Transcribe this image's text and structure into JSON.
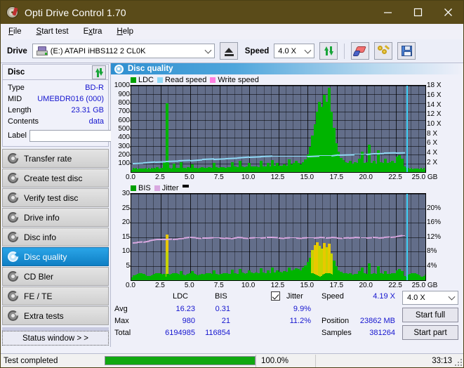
{
  "window": {
    "title": "Opti Drive Control 1.70",
    "icon": "disc-icon",
    "minimize": "minimize",
    "maximize": "maximize",
    "close": "close",
    "titlebar_color": "#5a4b19"
  },
  "menu": [
    {
      "label": "File",
      "accel": "F"
    },
    {
      "label": "Start test",
      "accel": "S"
    },
    {
      "label": "Extra",
      "accel": "x"
    },
    {
      "label": "Help",
      "accel": "H"
    }
  ],
  "toolbar": {
    "drive_label": "Drive",
    "drive_value": "(E:)  ATAPI iHBS112  2 CL0K",
    "eject_icon": "eject-icon",
    "speed_label": "Speed",
    "speed_value": "4.0 X",
    "refresh_icon": "refresh-icon",
    "erase_icon": "erase-icon",
    "keys_icon": "keys-icon",
    "save_icon": "save-icon"
  },
  "disc_panel": {
    "title": "Disc",
    "refresh_icon": "refresh-icon",
    "rows": [
      {
        "key": "Type",
        "value": "BD-R"
      },
      {
        "key": "MID",
        "value": "UMEBDR016 (000)"
      },
      {
        "key": "Length",
        "value": "23.31 GB"
      },
      {
        "key": "Contents",
        "value": "data"
      }
    ],
    "label_key": "Label",
    "label_value": "",
    "label_placeholder": "",
    "disc_button_icon": "disc-icon"
  },
  "sidebar": {
    "items": [
      {
        "label": "Transfer rate",
        "selected": false
      },
      {
        "label": "Create test disc",
        "selected": false
      },
      {
        "label": "Verify test disc",
        "selected": false
      },
      {
        "label": "Drive info",
        "selected": false
      },
      {
        "label": "Disc info",
        "selected": false
      },
      {
        "label": "Disc quality",
        "selected": true
      },
      {
        "label": "CD Bler",
        "selected": false
      },
      {
        "label": "FE / TE",
        "selected": false
      },
      {
        "label": "Extra tests",
        "selected": false
      }
    ],
    "status_window": "Status window > >"
  },
  "main": {
    "header_title": "Disc quality",
    "header_icon": "disc-quality-icon"
  },
  "stats": {
    "col_headers": [
      "LDC",
      "BIS"
    ],
    "row_labels": [
      "Avg",
      "Max",
      "Total"
    ],
    "ldc": {
      "avg": "16.23",
      "max": "980",
      "total": "6194985"
    },
    "bis": {
      "avg": "0.31",
      "max": "21",
      "total": "116854"
    },
    "jitter_label": "Jitter",
    "jitter_checked": true,
    "jitter_avg": "9.9%",
    "jitter_max": "11.2%",
    "speed_label": "Speed",
    "speed_value": "4.19 X",
    "position_label": "Position",
    "position_value": "23862 MB",
    "samples_label": "Samples",
    "samples_value": "381264",
    "speed_select": "4.0 X",
    "start_full": "Start full",
    "start_part": "Start part"
  },
  "statusbar": {
    "message": "Test completed",
    "progress_pct": "100.0%",
    "progress_value": 100,
    "elapsed": "33:13"
  },
  "chart_data": [
    {
      "type": "area",
      "name": "ldc-chart",
      "title": "",
      "xlabel": "GB",
      "ylabel": "",
      "legend": [
        {
          "label": "LDC",
          "color": "#00b400"
        },
        {
          "label": "Read speed",
          "color": "#8fd8f5"
        },
        {
          "label": "Write speed",
          "color": "#ff7fe0"
        }
      ],
      "legend_position": "top-left",
      "grid": true,
      "xlim": [
        0,
        25
      ],
      "xticks": [
        0.0,
        2.5,
        5.0,
        7.5,
        10.0,
        12.5,
        15.0,
        17.5,
        20.0,
        22.5,
        25.0
      ],
      "xtick_labels": [
        "0.0",
        "2.5",
        "5.0",
        "7.5",
        "10.0",
        "12.5",
        "15.0",
        "17.5",
        "20.0",
        "22.5",
        "25.0 GB"
      ],
      "ylim": [
        0,
        1000
      ],
      "yticks": [
        100,
        200,
        300,
        400,
        500,
        600,
        700,
        800,
        900,
        1000
      ],
      "ytick_labels": [
        "100",
        "200",
        "300",
        "400",
        "500",
        "600",
        "700",
        "800",
        "900",
        "1000"
      ],
      "y2lim": [
        0,
        18
      ],
      "y2ticks": [
        2,
        4,
        6,
        8,
        10,
        12,
        14,
        16,
        18
      ],
      "y2tick_labels": [
        "2 X",
        "4 X",
        "6 X",
        "8 X",
        "10 X",
        "12 X",
        "14 X",
        "16 X",
        "18 X"
      ],
      "cursor_x": 23.4,
      "series": [
        {
          "name": "LDC",
          "color": "#00b400",
          "x": [
            0.1,
            0.3,
            0.5,
            0.7,
            0.9,
            1.1,
            1.3,
            1.5,
            1.7,
            1.9,
            2.1,
            2.3,
            2.5,
            2.7,
            2.9,
            2.95,
            3.0,
            3.1,
            3.3,
            3.5,
            3.7,
            3.9,
            4.1,
            4.3,
            4.5,
            4.7,
            4.9,
            5.1,
            5.3,
            5.5,
            5.7,
            5.9,
            6.1,
            6.3,
            6.5,
            6.7,
            6.9,
            7.1,
            7.3,
            7.5,
            7.7,
            7.9,
            8.1,
            8.3,
            8.5,
            8.7,
            8.9,
            9.1,
            9.3,
            9.5,
            9.7,
            9.9,
            10.1,
            10.3,
            10.5,
            10.7,
            10.9,
            11.1,
            11.3,
            11.5,
            11.7,
            11.9,
            12.1,
            12.3,
            12.5,
            12.7,
            12.9,
            13.1,
            13.3,
            13.5,
            13.7,
            13.9,
            14.1,
            14.3,
            14.5,
            14.7,
            14.9,
            15.1,
            15.3,
            15.5,
            15.7,
            15.9,
            16.1,
            16.3,
            16.5,
            16.7,
            16.9,
            17.1,
            17.3,
            17.5,
            17.7,
            17.9,
            18.1,
            18.3,
            18.5,
            18.7,
            18.9,
            19.1,
            19.3,
            19.5,
            19.7,
            19.9,
            20.1,
            20.3,
            20.5,
            20.7,
            20.9,
            21.1,
            21.3,
            21.5,
            21.7,
            21.9,
            22.1,
            22.3,
            22.5,
            22.7,
            22.9,
            23.1,
            23.3
          ],
          "values": [
            45,
            40,
            38,
            42,
            40,
            44,
            38,
            40,
            42,
            45,
            60,
            48,
            50,
            120,
            800,
            520,
            110,
            55,
            48,
            100,
            52,
            50,
            120,
            55,
            48,
            60,
            52,
            90,
            55,
            48,
            52,
            60,
            55,
            50,
            58,
            52,
            110,
            60,
            55,
            58,
            62,
            55,
            60,
            58,
            120,
            65,
            60,
            130,
            70,
            62,
            68,
            110,
            70,
            65,
            70,
            62,
            130,
            70,
            65,
            110,
            68,
            140,
            75,
            110,
            80,
            75,
            90,
            80,
            150,
            95,
            110,
            130,
            110,
            95,
            120,
            150,
            210,
            300,
            430,
            560,
            700,
            820,
            760,
            900,
            820,
            980,
            700,
            520,
            340,
            240,
            170,
            140,
            120,
            110,
            130,
            100,
            120,
            110,
            160,
            240,
            110,
            120,
            320,
            110,
            130,
            100,
            260,
            120,
            110,
            160,
            110,
            120,
            130,
            110,
            180,
            200,
            160,
            70,
            50
          ]
        },
        {
          "name": "Read speed",
          "color": "#8fd8f5",
          "x": [
            0.1,
            1.0,
            2.0,
            2.9,
            4.0,
            5.0,
            6.0,
            7.0,
            8.0,
            9.0,
            10.0,
            11.0,
            12.0,
            13.0,
            14.0,
            15.0,
            16.0,
            17.0,
            17.6,
            19.0,
            20.0,
            20.6,
            21.5,
            22.5,
            23.3
          ],
          "values": [
            2.0,
            2.1,
            2.3,
            2.4,
            2.5,
            2.6,
            2.8,
            2.9,
            3.0,
            3.1,
            3.3,
            3.4,
            3.5,
            3.5,
            3.5,
            3.5,
            3.6,
            3.6,
            3.8,
            3.9,
            3.9,
            4.05,
            4.1,
            4.15,
            4.2
          ]
        }
      ]
    },
    {
      "type": "area",
      "name": "bis-jitter-chart",
      "title": "",
      "xlabel": "GB",
      "ylabel": "",
      "legend": [
        {
          "label": "BIS",
          "color": "#00b400"
        },
        {
          "label": "Jitter",
          "color": "#d9a8e0"
        }
      ],
      "legend_position": "top-left",
      "grid": true,
      "xlim": [
        0,
        25
      ],
      "xticks": [
        0.0,
        2.5,
        5.0,
        7.5,
        10.0,
        12.5,
        15.0,
        17.5,
        20.0,
        22.5,
        25.0
      ],
      "xtick_labels": [
        "0.0",
        "2.5",
        "5.0",
        "7.5",
        "10.0",
        "12.5",
        "15.0",
        "17.5",
        "20.0",
        "22.5",
        "25.0 GB"
      ],
      "ylim": [
        0,
        30
      ],
      "yticks": [
        5,
        10,
        15,
        20,
        25,
        30
      ],
      "ytick_labels": [
        "5",
        "10",
        "15",
        "20",
        "25",
        "30"
      ],
      "y2lim": [
        0,
        24
      ],
      "y2ticks": [
        4,
        8,
        12,
        16,
        20
      ],
      "y2tick_labels": [
        "4%",
        "8%",
        "12%",
        "16%",
        "20%"
      ],
      "cursor_x": 23.4,
      "series": [
        {
          "name": "BIS",
          "color": "#00b400",
          "x": [
            0.1,
            0.3,
            0.5,
            0.7,
            0.9,
            1.1,
            1.3,
            1.5,
            1.7,
            1.9,
            2.1,
            2.3,
            2.5,
            2.7,
            2.9,
            2.95,
            3.0,
            3.1,
            3.3,
            3.5,
            3.7,
            3.9,
            4.1,
            4.3,
            4.5,
            4.7,
            4.9,
            5.1,
            5.3,
            5.5,
            5.7,
            5.9,
            6.1,
            6.3,
            6.5,
            6.7,
            6.9,
            7.1,
            7.3,
            7.5,
            7.7,
            7.9,
            8.1,
            8.3,
            8.5,
            8.7,
            8.9,
            9.1,
            9.3,
            9.5,
            9.7,
            9.9,
            10.1,
            10.3,
            10.5,
            10.7,
            10.9,
            11.1,
            11.3,
            11.5,
            11.7,
            11.9,
            12.1,
            12.3,
            12.5,
            12.7,
            12.9,
            13.1,
            13.3,
            13.5,
            13.7,
            13.9,
            14.1,
            14.3,
            14.5,
            14.7,
            14.9,
            15.1,
            15.3,
            15.5,
            15.7,
            15.9,
            16.1,
            16.3,
            16.5,
            16.7,
            16.9,
            17.1,
            17.3,
            17.5,
            17.7,
            17.9,
            18.1,
            18.3,
            18.5,
            18.7,
            18.9,
            19.1,
            19.3,
            19.5,
            19.7,
            19.9,
            20.1,
            20.3,
            20.5,
            20.7,
            20.9,
            21.1,
            21.3,
            21.5,
            21.7,
            21.9,
            22.1,
            22.3,
            22.5,
            22.7,
            22.9,
            23.1,
            23.3
          ],
          "values": [
            1.8,
            1.6,
            1.5,
            1.8,
            1.6,
            1.8,
            1.5,
            1.7,
            1.6,
            1.8,
            2.2,
            1.8,
            1.9,
            2.4,
            16.0,
            10.0,
            2.4,
            2.0,
            1.8,
            2.6,
            2.0,
            1.9,
            3.2,
            2.0,
            1.8,
            2.2,
            2.0,
            3.4,
            2.1,
            1.9,
            2.0,
            2.3,
            2.1,
            2.0,
            2.2,
            2.0,
            3.6,
            2.3,
            2.1,
            2.2,
            2.4,
            2.1,
            2.3,
            2.2,
            3.8,
            2.5,
            2.3,
            4.0,
            2.7,
            2.4,
            2.6,
            3.6,
            2.7,
            2.5,
            2.7,
            2.4,
            4.2,
            2.7,
            2.5,
            3.6,
            2.6,
            4.4,
            2.9,
            3.6,
            3.0,
            2.9,
            3.4,
            3.0,
            4.6,
            3.5,
            3.8,
            4.2,
            4.0,
            3.6,
            4.4,
            5.2,
            6.5,
            8.0,
            10.5,
            12.2,
            13.2,
            12.0,
            11.0,
            13.0,
            11.5,
            12.8,
            9.5,
            7.0,
            5.0,
            3.6,
            3.0,
            2.6,
            2.4,
            2.2,
            2.6,
            2.1,
            2.4,
            2.2,
            3.2,
            4.6,
            2.2,
            2.4,
            6.0,
            2.3,
            2.6,
            2.1,
            5.0,
            2.4,
            2.2,
            3.2,
            2.2,
            2.4,
            2.6,
            2.2,
            3.6,
            4.0,
            3.2,
            1.6,
            1.2
          ]
        },
        {
          "name": "Jitter",
          "color": "#d9a8e0",
          "x": [
            0.1,
            0.5,
            1.0,
            1.5,
            1.8,
            2.2,
            2.6,
            3.0,
            3.5,
            4.0,
            4.5,
            5.0,
            5.5,
            6.0,
            6.5,
            7.0,
            7.5,
            8.0,
            8.5,
            9.0,
            9.5,
            10.0,
            10.5,
            11.0,
            11.5,
            12.0,
            12.5,
            13.0,
            13.5,
            14.0,
            14.5,
            15.0,
            15.5,
            16.0,
            16.5,
            17.0,
            17.5,
            18.0,
            18.5,
            19.0,
            19.5,
            20.0,
            20.5,
            21.0,
            21.5,
            22.0,
            22.5,
            23.0,
            23.3
          ],
          "values": [
            10.7,
            10.8,
            10.9,
            11.2,
            11.4,
            11.6,
            11.6,
            11.6,
            11.7,
            11.8,
            11.9,
            12.1,
            12.0,
            11.9,
            11.9,
            12.0,
            12.0,
            11.9,
            11.8,
            12.1,
            12.0,
            11.9,
            12.0,
            12.0,
            12.1,
            12.1,
            12.0,
            11.9,
            12.0,
            12.0,
            11.9,
            12.0,
            12.0,
            12.1,
            12.0,
            12.1,
            12.0,
            11.9,
            12.0,
            12.1,
            12.0,
            12.0,
            12.1,
            12.0,
            12.1,
            12.2,
            12.3,
            12.6,
            12.6
          ]
        }
      ]
    }
  ]
}
